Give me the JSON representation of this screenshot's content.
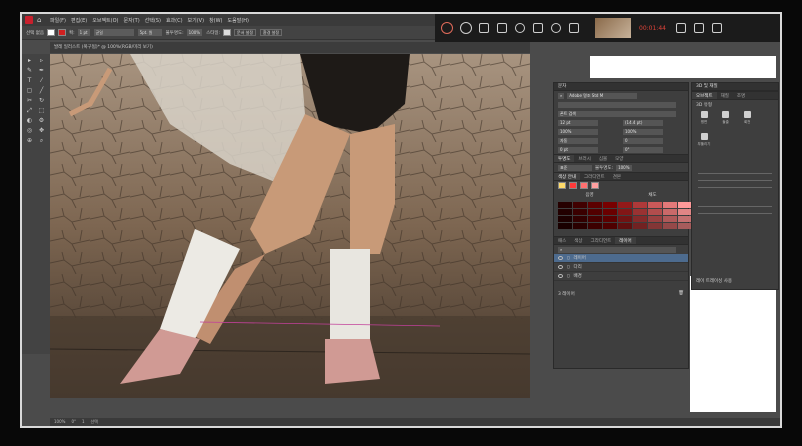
{
  "menubar": {
    "items": [
      "파일(F)",
      "편집(E)",
      "오브젝트(O)",
      "문자(T)",
      "선택(S)",
      "효과(C)",
      "보기(V)",
      "창(W)",
      "도움말(H)"
    ]
  },
  "recorder": {
    "time": "00:01:44",
    "accent": "#e0443a"
  },
  "controlbar": {
    "label_no_selection": "선택 없음",
    "stroke_label": "획:",
    "stroke_value": "1 pt",
    "line_label": "균일",
    "brush_value": "5pt. 원",
    "opacity_label": "불투명도:",
    "opacity_value": "100%",
    "style_label": "스타일:",
    "doc_setup": "문서 설정",
    "prefs": "환경 설정"
  },
  "document": {
    "tab_title": "발레 일러스트 (복구됨)* @ 100%(RGB/미리 보기)"
  },
  "character_panel": {
    "header": "문자",
    "font_name": "Adobe 명조 Std M",
    "font_style": "",
    "search_placeholder": "폰트 검색",
    "size_value": "12 pt",
    "leading_value": "(14.4 pt)",
    "tracking_value": "100%",
    "kerning_value": "100%",
    "vscale_value": "자동",
    "hscale_value": "0",
    "baseline_value": "0 pt",
    "rotate_value": "0°",
    "transparency_tabs": [
      "투명도",
      "브러시",
      "심볼",
      "모양"
    ],
    "blend_mode": "표준",
    "transparency_opacity_label": "불투명도:",
    "transparency_opacity": "100%",
    "color_guide_tabs": [
      "색상 안내",
      "그라디언트",
      "견본"
    ],
    "hue_label_left": "음영",
    "hue_label_right": "채도",
    "bottom_tabs": [
      "패스",
      "색상",
      "그라디언트",
      "레이어"
    ],
    "small_tab": "모양",
    "layers": [
      {
        "name": "레이어",
        "selected": true
      },
      {
        "name": "다리",
        "selected": false
      },
      {
        "name": "배경",
        "selected": false
      }
    ],
    "layer_count": "3 레이어"
  },
  "threed_panel": {
    "header": "3D 및 재질",
    "tabs": [
      "오브젝트",
      "재질",
      "조명"
    ],
    "section": "3D 유형",
    "types": [
      "평면",
      "돌출",
      "회전",
      "부풀리기"
    ],
    "footer": "레이 트레이싱 사용"
  },
  "statusbar": {
    "zoom": "100%",
    "rotation": "0°",
    "artboard": "1",
    "tool": "선택"
  },
  "colors": {
    "swatches_row": [
      "#ff3a3a",
      "#ff7070",
      "#ffa0a0"
    ],
    "accent_selection": "#4d6b8e"
  },
  "tools": [
    "▸",
    "▹",
    "✎",
    "✒",
    "T",
    "⁄",
    "▢",
    "╱",
    "✂",
    "↻",
    "⤢",
    "⬚",
    "◐",
    "⚙",
    "◎",
    "✥",
    "⊕",
    "⌕"
  ]
}
